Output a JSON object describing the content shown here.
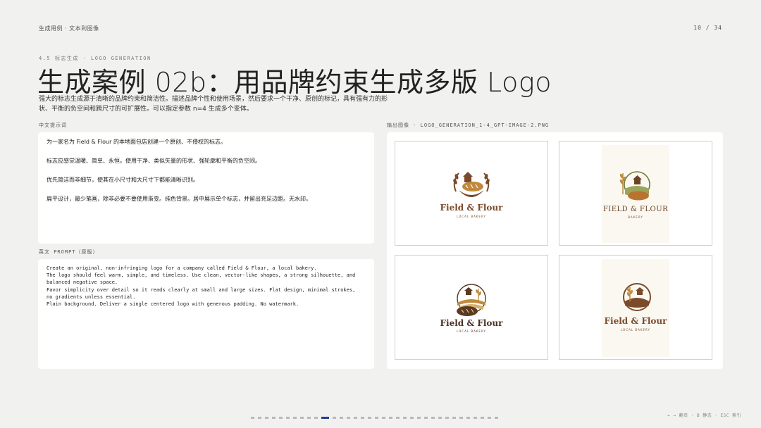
{
  "header": {
    "breadcrumb": "生成用例 · 文本到图像",
    "page_number": "10 / 34"
  },
  "section": {
    "label": "4.5 标志生成 · LOGO GENERATION",
    "title": "生成案例 02b：用品牌约束生成多版 Logo",
    "description": "强大的标志生成源于清晰的品牌约束和简洁性。描述品牌个性和使用场景，然后要求一个干净、原创的标记，具有强有力的形状、平衡的负空间和跨尺寸的可扩展性。可以指定参数  n=4  生成多个变体。"
  },
  "chinese_prompt": {
    "label": "中文提示词",
    "paragraphs": [
      "为一家名为 Field & Flour 的本地面包店创建一个原创、不侵权的标志。",
      "标志应感觉温暖、简单、永恒。使用干净、类似矢量的形状、强轮廓和平衡的负空间。",
      "优先简洁而非细节，使其在小尺寸和大尺寸下都能清晰识别。",
      "扁平设计，最少笔画，除非必要不要使用渐变。纯色背景。居中展示单个标志，并留出充足边距。无水印。"
    ]
  },
  "english_prompt": {
    "label": "英文 PROMPT（原版）",
    "text": "Create an original, non-infringing logo for a company called Field & Flour, a local bakery.\nThe logo should feel warm, simple, and timeless. Use clean, vector-like shapes, a strong silhouette, and\nbalanced negative space.\nFavor simplicity over detail so it reads clearly at small and large sizes. Flat design, minimal strokes,\nno gradients unless essential.\nPlain background. Deliver a single centered logo with generous padding. No watermark."
  },
  "output": {
    "label": "输出图像 · LOGO_GENERATION_1-4_GPT-IMAGE-2.PNG",
    "logos": [
      {
        "brand": "Field & Flour",
        "tagline": "LOCAL BAKERY",
        "variant": "wheat-wreath-bread-bowl",
        "bg": "#ffffff",
        "color": "#7a4a2a"
      },
      {
        "brand": "FIELD & FLOUR",
        "tagline": "BAKERY",
        "variant": "farmhouse-field-bread",
        "bg": "#fbf8f1",
        "color": "#6b4226"
      },
      {
        "brand": "Field & Flour",
        "tagline": "LOCAL BAKERY",
        "variant": "circle-farm-loaf",
        "bg": "#ffffff",
        "color": "#5a3a22"
      },
      {
        "brand": "Field & Flour",
        "tagline": "LOCAL BAKERY",
        "variant": "ring-wheat-farmhouse",
        "bg": "#fbf8f1",
        "color": "#7a4a2a"
      }
    ]
  },
  "footer": {
    "hints": "← → 翻页 · B 静态 · ESC 索引",
    "pager_total": 35,
    "pager_active": 10
  },
  "colors": {
    "accent": "#2a3d8f",
    "background": "#f1f1ef",
    "brown": "#7a4a2a",
    "wheat": "#c08a3e",
    "green": "#6b7a3a"
  }
}
